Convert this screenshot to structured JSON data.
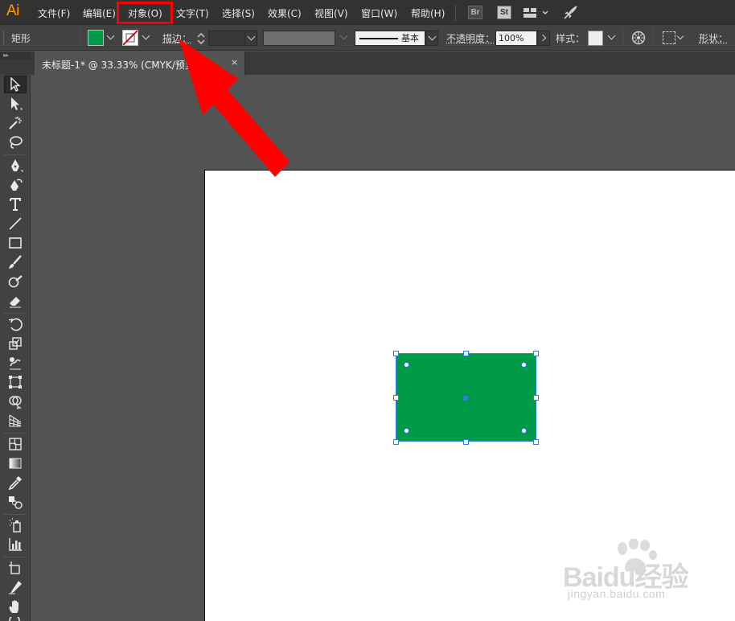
{
  "app": {
    "logo": "Ai"
  },
  "menu": {
    "items": [
      {
        "label": "文件(F)"
      },
      {
        "label": "编辑(E)"
      },
      {
        "label": "对象(O)"
      },
      {
        "label": "文字(T)"
      },
      {
        "label": "选择(S)"
      },
      {
        "label": "效果(C)"
      },
      {
        "label": "视图(V)"
      },
      {
        "label": "窗口(W)"
      },
      {
        "label": "帮助(H)"
      }
    ],
    "bridge_label": "Br",
    "stock_label": "St"
  },
  "control": {
    "object_type": "矩形",
    "fill_color": "#009b48",
    "stroke_label": "描边：",
    "stroke_profile_label": "基本",
    "opacity_label": "不透明度：",
    "opacity_value": "100%",
    "style_label": "样式：",
    "shape_label": "形状："
  },
  "document": {
    "tab_title": "未标题-1* @ 33.33% (CMYK/预览)",
    "close_glyph": "×"
  },
  "artwork": {
    "rect_fill": "#009b48",
    "selection_color": "#2d7fd8"
  },
  "annotation": {
    "highlight_color": "#ff0000",
    "highlight_target": "对象(O)"
  },
  "watermark": {
    "main": "Baidu经验",
    "sub": "jingyan.baidu.com"
  }
}
